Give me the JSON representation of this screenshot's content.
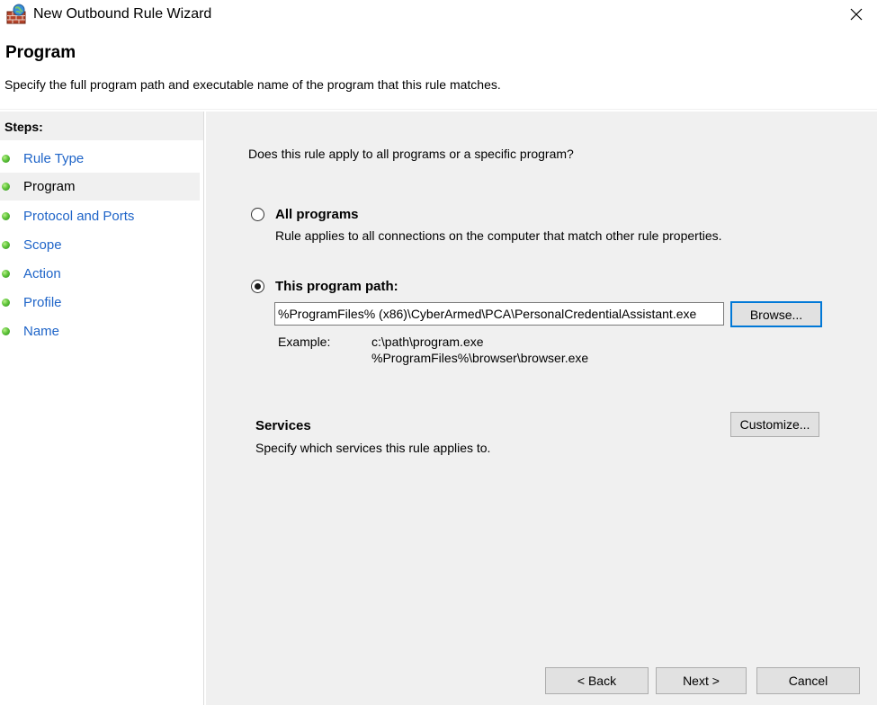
{
  "window": {
    "title": "New Outbound Rule Wizard",
    "app_icon": "firewall-icon",
    "close_icon": "close-icon"
  },
  "header": {
    "title": "Program",
    "subtitle": "Specify the full program path and executable name of the program that this rule matches."
  },
  "steps": {
    "heading": "Steps:",
    "items": [
      {
        "label": "Rule Type",
        "current": false
      },
      {
        "label": "Program",
        "current": true
      },
      {
        "label": "Protocol and Ports",
        "current": false
      },
      {
        "label": "Scope",
        "current": false
      },
      {
        "label": "Action",
        "current": false
      },
      {
        "label": "Profile",
        "current": false
      },
      {
        "label": "Name",
        "current": false
      }
    ]
  },
  "main": {
    "question": "Does this rule apply to all programs or a specific program?",
    "all_programs": {
      "label": "All programs",
      "description": "Rule applies to all connections on the computer that match other rule properties.",
      "selected": false
    },
    "this_program": {
      "label": "This program path:",
      "selected": true,
      "path_value": "%ProgramFiles% (x86)\\CyberArmed\\PCA\\PersonalCredentialAssistant.exe",
      "browse_label": "Browse...",
      "example_label": "Example:",
      "example_lines": [
        "c:\\path\\program.exe",
        "%ProgramFiles%\\browser\\browser.exe"
      ]
    },
    "services": {
      "title": "Services",
      "description": "Specify which services this rule applies to.",
      "customize_label": "Customize..."
    }
  },
  "footer": {
    "back_label": "< Back",
    "next_label": "Next >",
    "cancel_label": "Cancel"
  },
  "colors": {
    "link_blue": "#1e64c8",
    "content_bg": "#f0f0f0",
    "focus_border": "#0078d7",
    "step_dot_green": "#5fc43a"
  }
}
